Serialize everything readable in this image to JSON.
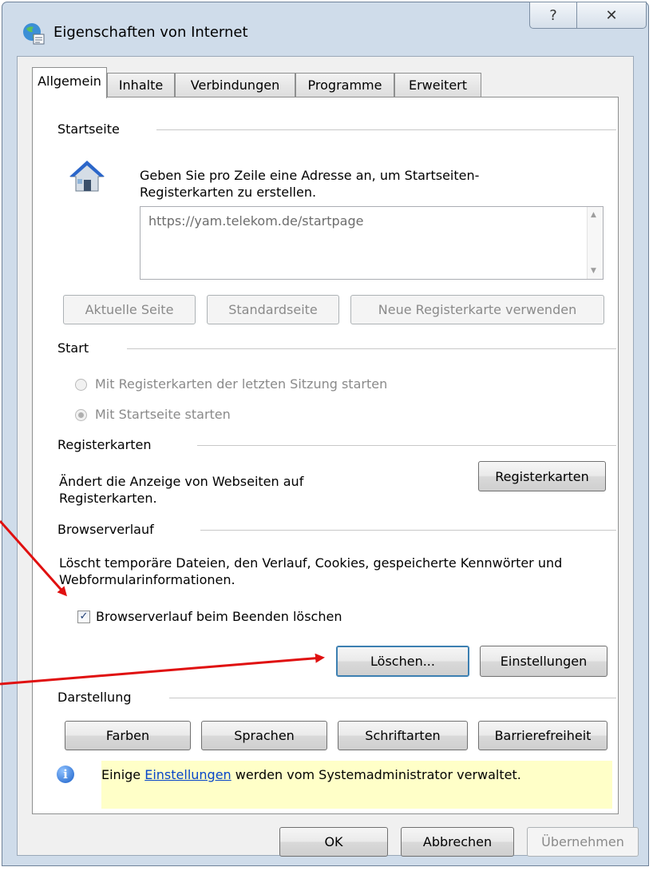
{
  "window": {
    "title": "Eigenschaften von Internet",
    "help_glyph": "?",
    "close_glyph": "✕"
  },
  "tabs": [
    {
      "label": "Allgemein"
    },
    {
      "label": "Inhalte"
    },
    {
      "label": "Verbindungen"
    },
    {
      "label": "Programme"
    },
    {
      "label": "Erweitert"
    }
  ],
  "startseite": {
    "heading": "Startseite",
    "description": "Geben Sie pro Zeile eine Adresse an, um Startseiten-Registerkarten zu erstellen.",
    "url_value": "https://yam.telekom.de/startpage",
    "btn_current": "Aktuelle Seite",
    "btn_default": "Standardseite",
    "btn_newtab": "Neue Registerkarte verwenden"
  },
  "start": {
    "heading": "Start",
    "option_last_session": "Mit Registerkarten der letzten Sitzung starten",
    "option_homepage": "Mit Startseite starten"
  },
  "registerkarten": {
    "heading": "Registerkarten",
    "description": "Ändert die Anzeige von Webseiten auf Registerkarten.",
    "button": "Registerkarten"
  },
  "browserverlauf": {
    "heading": "Browserverlauf",
    "description": "Löscht temporäre Dateien, den Verlauf, Cookies, gespeicherte Kennwörter und Webformularinformationen.",
    "checkbox_label": "Browserverlauf beim Beenden löschen",
    "checkbox_glyph": "✓",
    "btn_delete": "Löschen...",
    "btn_settings": "Einstellungen"
  },
  "darstellung": {
    "heading": "Darstellung",
    "btn_colors": "Farben",
    "btn_languages": "Sprachen",
    "btn_fonts": "Schriftarten",
    "btn_accessibility": "Barrierefreiheit"
  },
  "info": {
    "glyph": "i",
    "text_before": "Einige ",
    "link": "Einstellungen",
    "text_after": " werden vom Systemadministrator verwaltet."
  },
  "footer": {
    "ok": "OK",
    "cancel": "Abbrechen",
    "apply": "Übernehmen"
  },
  "colors": {
    "annotation_arrow": "#e01010",
    "dialog_frame": "#cfdcea",
    "info_bar": "#ffffc8"
  }
}
